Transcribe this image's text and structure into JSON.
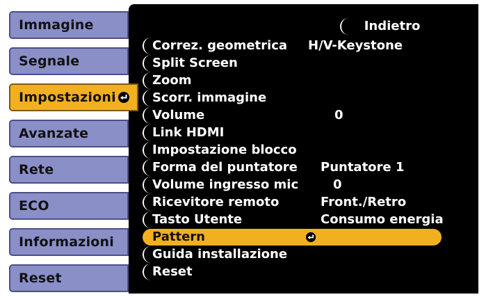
{
  "sidebar": {
    "items": [
      {
        "label": "Immagine",
        "active": false
      },
      {
        "label": "Segnale",
        "active": false
      },
      {
        "label": "Impostazioni",
        "active": true
      },
      {
        "label": "Avanzate",
        "active": false
      },
      {
        "label": "Rete",
        "active": false
      },
      {
        "label": "ECO",
        "active": false
      },
      {
        "label": "Informazioni",
        "active": false
      },
      {
        "label": "Reset",
        "active": false
      }
    ]
  },
  "menu": {
    "back_label": "Indietro",
    "items": [
      {
        "label": "Correz. geometrica",
        "value": "H/V-Keystone"
      },
      {
        "label": "Split Screen",
        "value": ""
      },
      {
        "label": "Zoom",
        "value": ""
      },
      {
        "label": "Scorr. immagine",
        "value": ""
      },
      {
        "label": "Volume",
        "value": "0"
      },
      {
        "label": "Link HDMI",
        "value": ""
      },
      {
        "label": "Impostazione blocco",
        "value": ""
      },
      {
        "label": "Forma del puntatore",
        "value": "Puntatore 1"
      },
      {
        "label": "Volume ingresso mic",
        "value": "0"
      },
      {
        "label": "Ricevitore remoto",
        "value": "Front./Retro"
      },
      {
        "label": "Tasto Utente",
        "value": "Consumo energia"
      },
      {
        "label": "Pattern",
        "value": "",
        "selected": true
      },
      {
        "label": "Guida installazione",
        "value": ""
      },
      {
        "label": "Reset",
        "value": ""
      }
    ]
  },
  "icons": {
    "enter": "enter-icon"
  },
  "colors": {
    "tab_bg": "#8a8fc8",
    "tab_active": "#f2b020",
    "panel_bg": "#000000",
    "highlight": "#f2b020",
    "text_light": "#ffffff"
  }
}
